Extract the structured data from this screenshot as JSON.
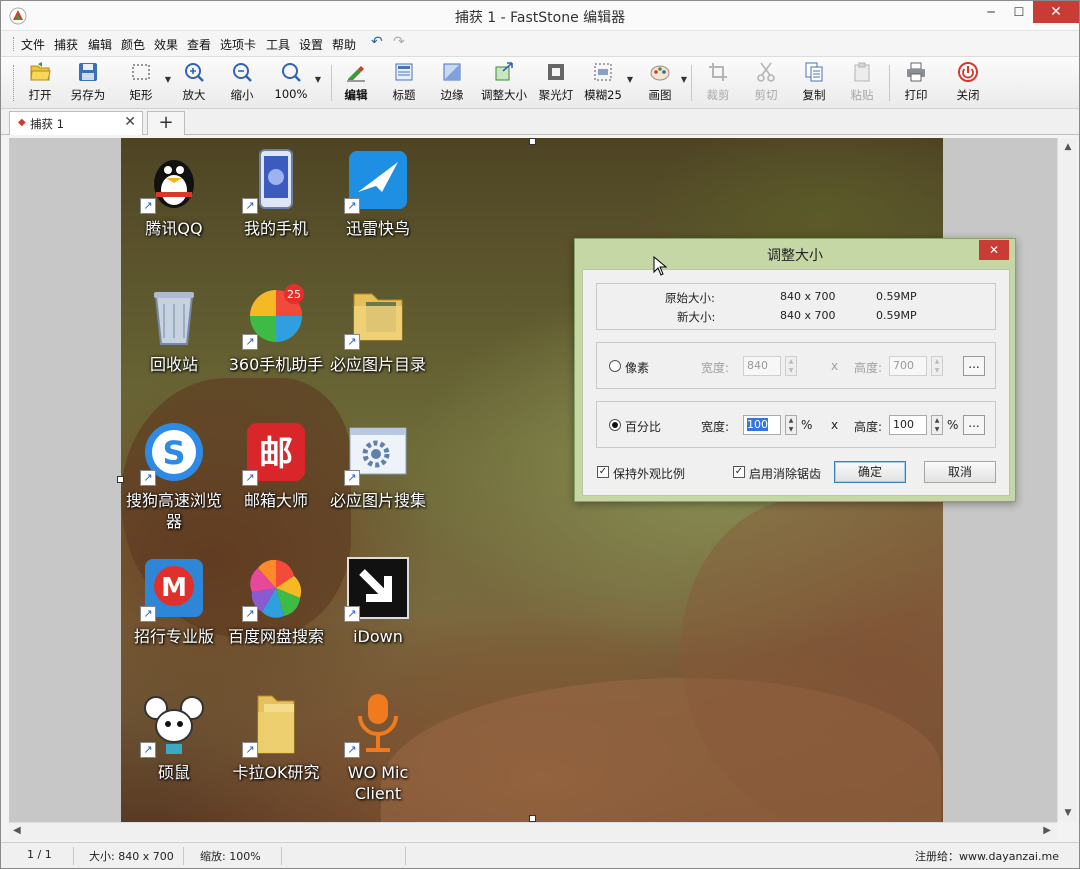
{
  "window": {
    "title": "捕获 1 - FastStone 编辑器",
    "minimize_glyph": "─",
    "maximize_glyph": "☐",
    "close_glyph": "✕"
  },
  "menu": {
    "items": [
      "文件",
      "捕获",
      "编辑",
      "颜色",
      "效果",
      "查看",
      "选项卡",
      "工具",
      "设置",
      "帮助"
    ],
    "undo_glyph": "↶",
    "redo_glyph": "↷"
  },
  "toolbar": {
    "open": "打开",
    "save_as": "另存为",
    "rectangle": "矩形",
    "zoom_in": "放大",
    "zoom_out": "缩小",
    "zoom_level": "100%",
    "edit": "编辑",
    "caption": "标题",
    "edge": "边缘",
    "resize": "调整大小",
    "spotlight": "聚光灯",
    "blur": "模糊25",
    "draw": "画图",
    "crop": "裁剪",
    "cut": "剪切",
    "copy": "复制",
    "paste": "粘贴",
    "print": "打印",
    "close": "关闭",
    "dropdown_glyph": "▼"
  },
  "tabs": [
    {
      "label": "捕获 1",
      "marker": "◆",
      "close_glyph": "✕"
    }
  ],
  "tab_add_glyph": "+",
  "scroll": {
    "up": "▲",
    "down": "▼",
    "left": "◀",
    "right": "▶"
  },
  "desktop_icons": [
    {
      "name": "腾讯QQ",
      "icon": "qq-penguin-icon"
    },
    {
      "name": "我的手机",
      "icon": "phone-icon"
    },
    {
      "name": "迅雷快鸟",
      "icon": "thunder-bird-icon"
    },
    {
      "name": "回收站",
      "icon": "recycle-bin-icon"
    },
    {
      "name": "360手机助手",
      "icon": "360-assistant-icon",
      "badge": "25"
    },
    {
      "name": "必应图片目录",
      "icon": "folder-icon"
    },
    {
      "name": "搜狗高速浏览器",
      "icon": "sogou-browser-icon",
      "glyph": "S"
    },
    {
      "name": "邮箱大师",
      "icon": "mail-master-icon",
      "glyph": "邮"
    },
    {
      "name": "必应图片搜集",
      "icon": "gear-window-icon"
    },
    {
      "name": "招行专业版",
      "icon": "cmb-bank-icon",
      "glyph": "M"
    },
    {
      "name": "百度网盘搜索",
      "icon": "pinwheel-icon"
    },
    {
      "name": "iDown",
      "icon": "download-arrow-icon"
    },
    {
      "name": "硕鼠",
      "icon": "mouse-mascot-icon"
    },
    {
      "name": "卡拉OK研究",
      "icon": "folder-icon"
    },
    {
      "name": "WO Mic Client",
      "icon": "microphone-icon"
    }
  ],
  "shortcut_glyph": "↗",
  "dialog": {
    "title": "调整大小",
    "close_glyph": "✕",
    "original_size_label": "原始大小:",
    "original_size": "840 x 700",
    "original_mp": "0.59MP",
    "new_size_label": "新大小:",
    "new_size": "840 x 700",
    "new_mp": "0.59MP",
    "pixel_option": "像素",
    "pixel_selected": false,
    "width_label": "宽度:",
    "height_label": "高度:",
    "pixel_width": "840",
    "pixel_height": "700",
    "times": "x",
    "percent_option": "百分比",
    "percent_selected": true,
    "percent_width": "100",
    "percent_height": "100",
    "percent_unit": "%",
    "browse": "...",
    "keep_aspect": "保持外观比例",
    "keep_aspect_checked": true,
    "antialias": "启用消除锯齿",
    "antialias_checked": true,
    "check_glyph": "✓",
    "ok": "确定",
    "cancel": "取消"
  },
  "status": {
    "page": "1 / 1",
    "size": "大小: 840 x 700",
    "zoom": "缩放: 100%",
    "registered": "注册给：www.dayanzai.me"
  },
  "colors": {
    "dialog_frame": "#c5d7a5",
    "close_red": "#c83c35",
    "canvas_bg": "#c7c7c7"
  }
}
